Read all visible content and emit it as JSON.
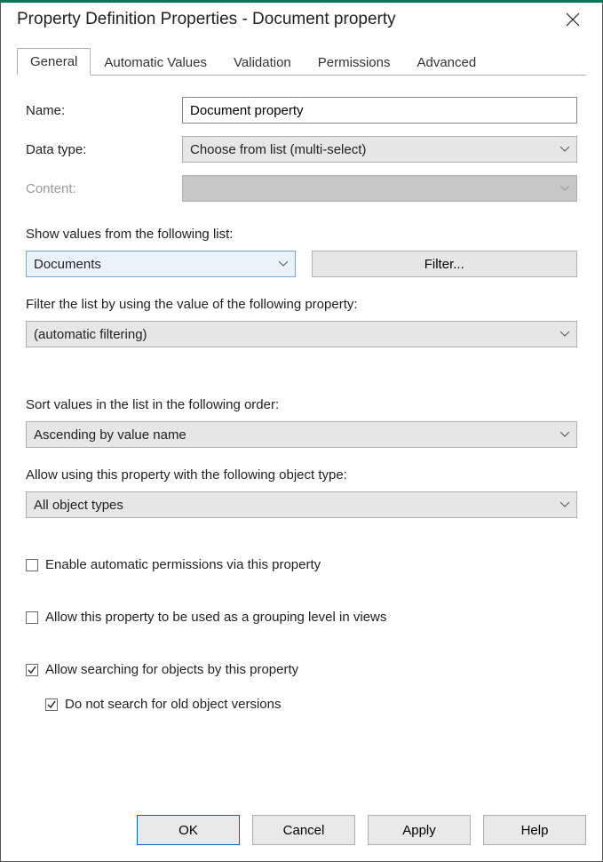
{
  "window": {
    "title": "Property Definition Properties - Document property"
  },
  "tabs": [
    "General",
    "Automatic Values",
    "Validation",
    "Permissions",
    "Advanced"
  ],
  "activeTab": "General",
  "general": {
    "name_label": "Name:",
    "name_value": "Document property",
    "datatype_label": "Data type:",
    "datatype_value": "Choose from list (multi-select)",
    "content_label": "Content:",
    "content_value": "",
    "show_values_label": "Show values from the following list:",
    "show_values_value": "Documents",
    "filter_button": "Filter...",
    "filter_list_label": "Filter the list by using the value of the following property:",
    "filter_list_value": "(automatic filtering)",
    "sort_label": "Sort values in the list in the following order:",
    "sort_value": "Ascending by value name",
    "allow_object_label": "Allow using this property with the following object type:",
    "allow_object_value": "All object types",
    "checkboxes": {
      "enable_auto_perms": {
        "label": "Enable automatic permissions via this property",
        "checked": false
      },
      "allow_grouping": {
        "label": "Allow this property to be used as a grouping level in views",
        "checked": false
      },
      "allow_searching": {
        "label": "Allow searching for objects by this property",
        "checked": true
      },
      "no_old_versions": {
        "label": "Do not search for old object versions",
        "checked": true
      }
    }
  },
  "buttons": {
    "ok": "OK",
    "cancel": "Cancel",
    "apply": "Apply",
    "help": "Help"
  }
}
